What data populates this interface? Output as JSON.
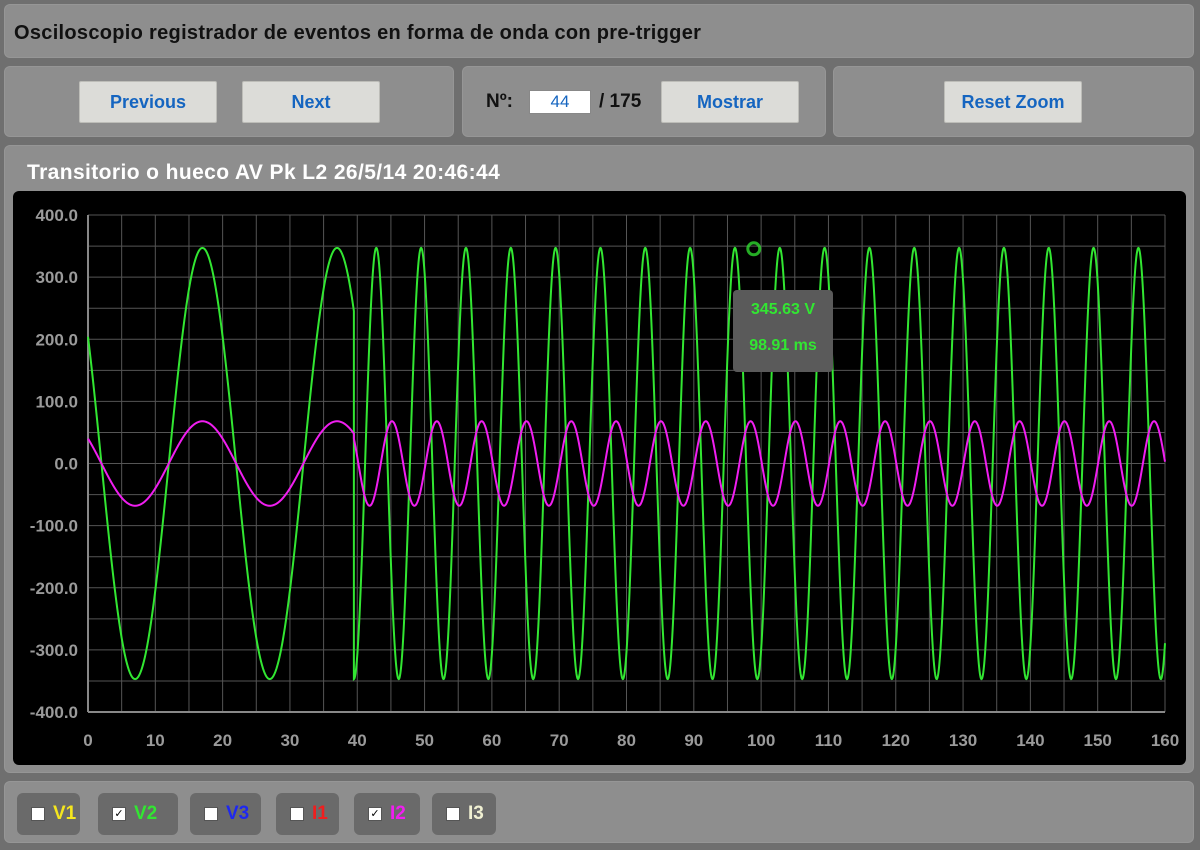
{
  "header": {
    "title": "Osciloscopio registrador de eventos en forma de onda con pre-trigger"
  },
  "nav": {
    "previous_label": "Previous",
    "next_label": "Next"
  },
  "record": {
    "number_label": "Nº:",
    "current": "44",
    "total_label": "/ 175",
    "show_label": "Mostrar"
  },
  "zoom": {
    "reset_label": "Reset Zoom"
  },
  "chart_title": "Transitorio o hueco AV Pk L2 26/5/14 20:46:44",
  "tooltip": {
    "value": "345.63 V",
    "time": "98.91 ms"
  },
  "legend": [
    {
      "label": "V1",
      "checked": false,
      "color": "#f5e61e"
    },
    {
      "label": "V2",
      "checked": true,
      "color": "#32e632"
    },
    {
      "label": "V3",
      "checked": false,
      "color": "#1e28f0"
    },
    {
      "label": "I1",
      "checked": false,
      "color": "#f01e1e"
    },
    {
      "label": "I2",
      "checked": true,
      "color": "#f01ef0"
    },
    {
      "label": "I3",
      "checked": false,
      "color": "#f0f0d2"
    }
  ],
  "chart_data": {
    "type": "line",
    "xlim": [
      0,
      160
    ],
    "ylim": [
      -400,
      400
    ],
    "xticks": [
      "0",
      "10",
      "20",
      "30",
      "40",
      "50",
      "60",
      "70",
      "80",
      "90",
      "100",
      "110",
      "120",
      "130",
      "140",
      "150",
      "160"
    ],
    "yticks": [
      "400.0",
      "300.0",
      "200.0",
      "100.0",
      "0.0",
      "-100.0",
      "-200.0",
      "-300.0",
      "-400.0"
    ],
    "series": [
      {
        "name": "V2",
        "color": "#32e632",
        "segments": [
          {
            "x_start": 0,
            "x_end": 39.5,
            "amplitude": 347,
            "period_ms": 20,
            "phase_deg": 144
          },
          {
            "x_start": 39.5,
            "x_end": 160,
            "amplitude": 347,
            "period_ms": 6.66,
            "phase_deg": -90
          }
        ]
      },
      {
        "name": "I2",
        "color": "#f01ef0",
        "segments": [
          {
            "x_start": 0,
            "x_end": 39.5,
            "amplitude": 68,
            "period_ms": 20,
            "phase_deg": 144
          },
          {
            "x_start": 39.5,
            "x_end": 160,
            "amplitude": 68,
            "period_ms": 6.66,
            "phase_deg": 144
          }
        ]
      }
    ],
    "highlight_point": {
      "x": 98.91,
      "y": 345.63,
      "color": "#32e632"
    }
  }
}
